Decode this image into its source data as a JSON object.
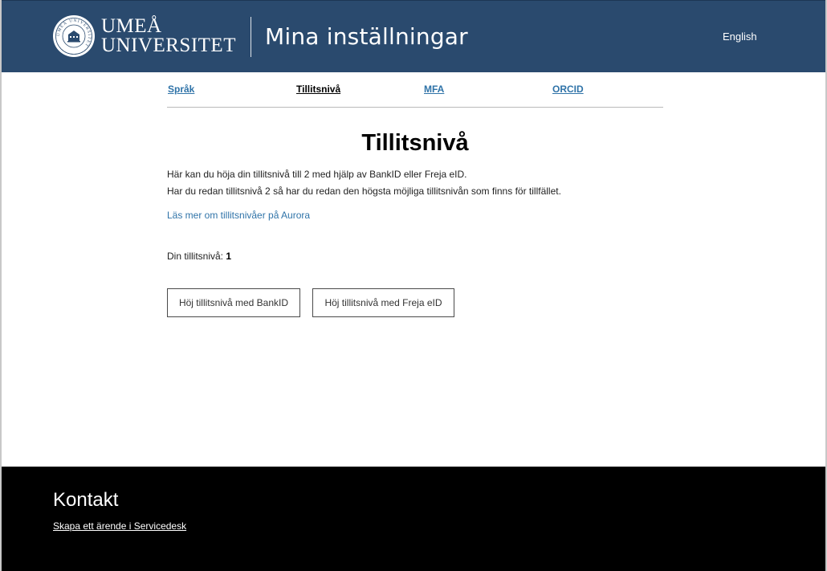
{
  "header": {
    "logo_ring_text": "UMEÅ UNIVERSITET",
    "university_line1": "UMEÅ",
    "university_line2": "UNIVERSITET",
    "app_title": "Mina inställningar",
    "language_link": "English",
    "background_color": "#2a4a6e"
  },
  "nav": {
    "tabs": [
      {
        "label": "Språk",
        "active": false
      },
      {
        "label": "Tillitsnivå",
        "active": true
      },
      {
        "label": "MFA",
        "active": false
      },
      {
        "label": "ORCID",
        "active": false
      }
    ],
    "link_color": "#2f73a8"
  },
  "main": {
    "title": "Tillitsnivå",
    "description_line1": "Här kan du höja din tillitsnivå till 2 med hjälp av BankID eller Freja eID.",
    "description_line2": "Har du redan tillitsnivå 2 så har du redan den högsta möjliga tillitsnivån som finns för tillfället.",
    "info_link": "Läs mer om tillitsnivåer på Aurora",
    "level_label": "Din tillitsnivå:",
    "level_value": "1",
    "buttons": {
      "bankid": "Höj tillitsnivå med BankID",
      "freja": "Höj tillitsnivå med Freja eID"
    }
  },
  "footer": {
    "title": "Kontakt",
    "link": "Skapa ett ärende i Servicedesk"
  }
}
